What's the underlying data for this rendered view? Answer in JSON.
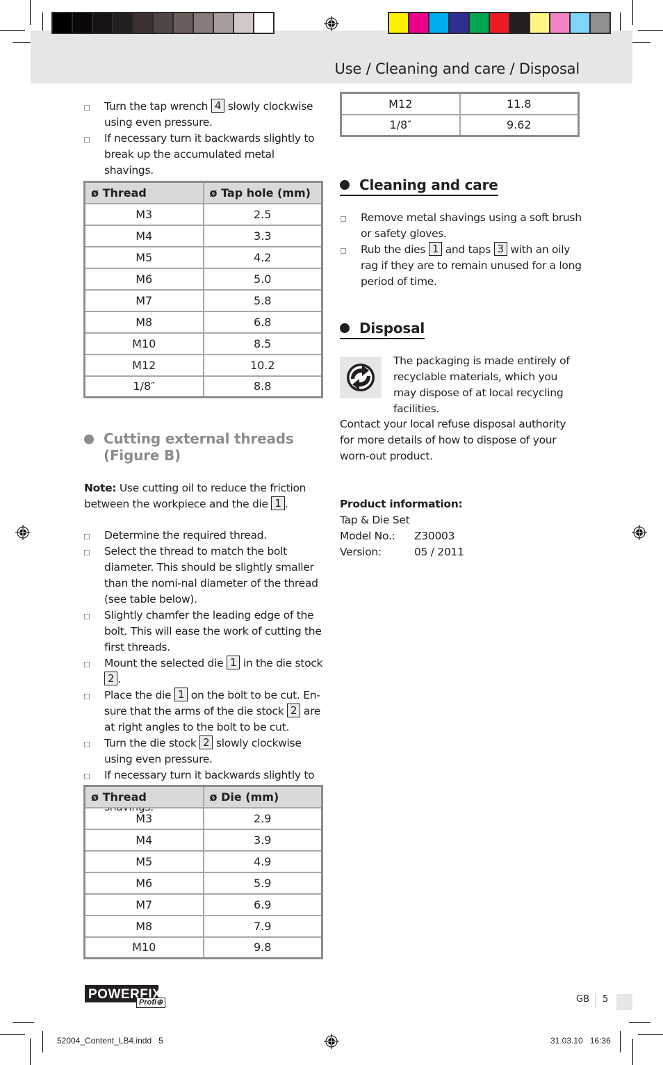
{
  "header": {
    "title": "Use / Cleaning and care / Disposal",
    "grayscale_bar": [
      "#000000",
      "#0a0808",
      "#171312",
      "#231f1e",
      "#3b3130",
      "#504645",
      "#6a5e5c",
      "#877a78",
      "#a79d9b",
      "#d0c9c7",
      "#ffffff"
    ],
    "process_bar": [
      "#fff200",
      "#ec008c",
      "#00aeef",
      "#2e3192",
      "#00a651",
      "#ed1c24",
      "#231f20",
      "#fff685",
      "#f384c3",
      "#7dd5f7",
      "#8f8f8f"
    ]
  },
  "left": {
    "intro_bullets": [
      {
        "before": "Turn the tap wrench",
        "ref": "4",
        "after": "slowly clockwise using even pressure."
      },
      {
        "before": "If necessary turn it backwards slightly to break up the accumulated metal shavings.",
        "ref": null,
        "after": ""
      }
    ],
    "tap_table": {
      "headers": [
        "ø Thread",
        "ø Tap hole (mm)"
      ],
      "rows": [
        [
          "M3",
          "2.5"
        ],
        [
          "M4",
          "3.3"
        ],
        [
          "M5",
          "4.2"
        ],
        [
          "M6",
          "5.0"
        ],
        [
          "M7",
          "5.8"
        ],
        [
          "M8",
          "6.8"
        ],
        [
          "M10",
          "8.5"
        ],
        [
          "M12",
          "10.2"
        ],
        [
          "1/8″",
          "8.8"
        ]
      ]
    },
    "external_heading": "Cutting external threads (Figure B)",
    "note": {
      "label": "Note:",
      "text": "Use cutting oil to reduce the friction between the workpiece and the die",
      "ref": "1",
      "after": "."
    },
    "steps": [
      {
        "segments": [
          {
            "t": "Determine the required thread."
          }
        ]
      },
      {
        "segments": [
          {
            "t": "Select the thread to match the bolt diameter. This should be slightly smaller than the nomi-nal diameter of the thread (see table below)."
          }
        ]
      },
      {
        "segments": [
          {
            "t": "Slightly chamfer the leading edge of the bolt. This will ease the work of cutting the first threads."
          }
        ]
      },
      {
        "segments": [
          {
            "t": "Mount the selected die "
          },
          {
            "ref": "1"
          },
          {
            "t": " in the die stock "
          },
          {
            "ref": "2"
          },
          {
            "t": "."
          }
        ]
      },
      {
        "segments": [
          {
            "t": "Place the die "
          },
          {
            "ref": "1"
          },
          {
            "t": " on the bolt to be cut. En-sure that the arms of the die stock "
          },
          {
            "ref": "2"
          },
          {
            "t": " are at right angles to the bolt to be cut."
          }
        ]
      },
      {
        "segments": [
          {
            "t": "Turn the die stock "
          },
          {
            "ref": "2"
          },
          {
            "t": " slowly clockwise using even pressure."
          }
        ]
      },
      {
        "segments": [
          {
            "t": "If necessary turn it backwards slightly to break up the accumulated metal shavings."
          }
        ]
      }
    ],
    "die_table": {
      "headers": [
        "ø Thread",
        "ø Die (mm)"
      ],
      "rows": [
        [
          "M3",
          "2.9"
        ],
        [
          "M4",
          "3.9"
        ],
        [
          "M5",
          "4.9"
        ],
        [
          "M6",
          "5.9"
        ],
        [
          "M7",
          "6.9"
        ],
        [
          "M8",
          "7.9"
        ],
        [
          "M10",
          "9.8"
        ]
      ]
    }
  },
  "right": {
    "die_table_cont": {
      "rows": [
        [
          "M12",
          "11.8"
        ],
        [
          "1/8″",
          "9.62"
        ]
      ]
    },
    "cleaning_heading": "Cleaning and care",
    "cleaning_bullets": [
      {
        "segments": [
          {
            "t": "Remove metal shavings using a soft brush or safety gloves."
          }
        ]
      },
      {
        "segments": [
          {
            "t": "Rub the dies "
          },
          {
            "ref": "1"
          },
          {
            "t": " and taps "
          },
          {
            "ref": "3"
          },
          {
            "t": " with an oily rag if they are to remain unused for a long period of time."
          }
        ]
      }
    ],
    "disposal_heading": "Disposal",
    "packaging_text": "The packaging is made entirely of recyclable materials, which you may dispose of at local recycling facilities.",
    "contact_text": "Contact your local refuse disposal authority for more details of how to dispose of your worn-out product.",
    "product_info": {
      "heading": "Product information:",
      "name": "Tap & Die Set",
      "model_label": "Model No.:",
      "model_value": "Z30003",
      "version_label": "Version:",
      "version_value": "05 / 2011"
    }
  },
  "footer": {
    "logo_main": "POWERFIX",
    "logo_sub": "Profi⊕",
    "language": "GB",
    "page_number": "5",
    "slug_file": "52004_Content_LB4.indd   5",
    "slug_date": "31.03.10   16:36"
  }
}
